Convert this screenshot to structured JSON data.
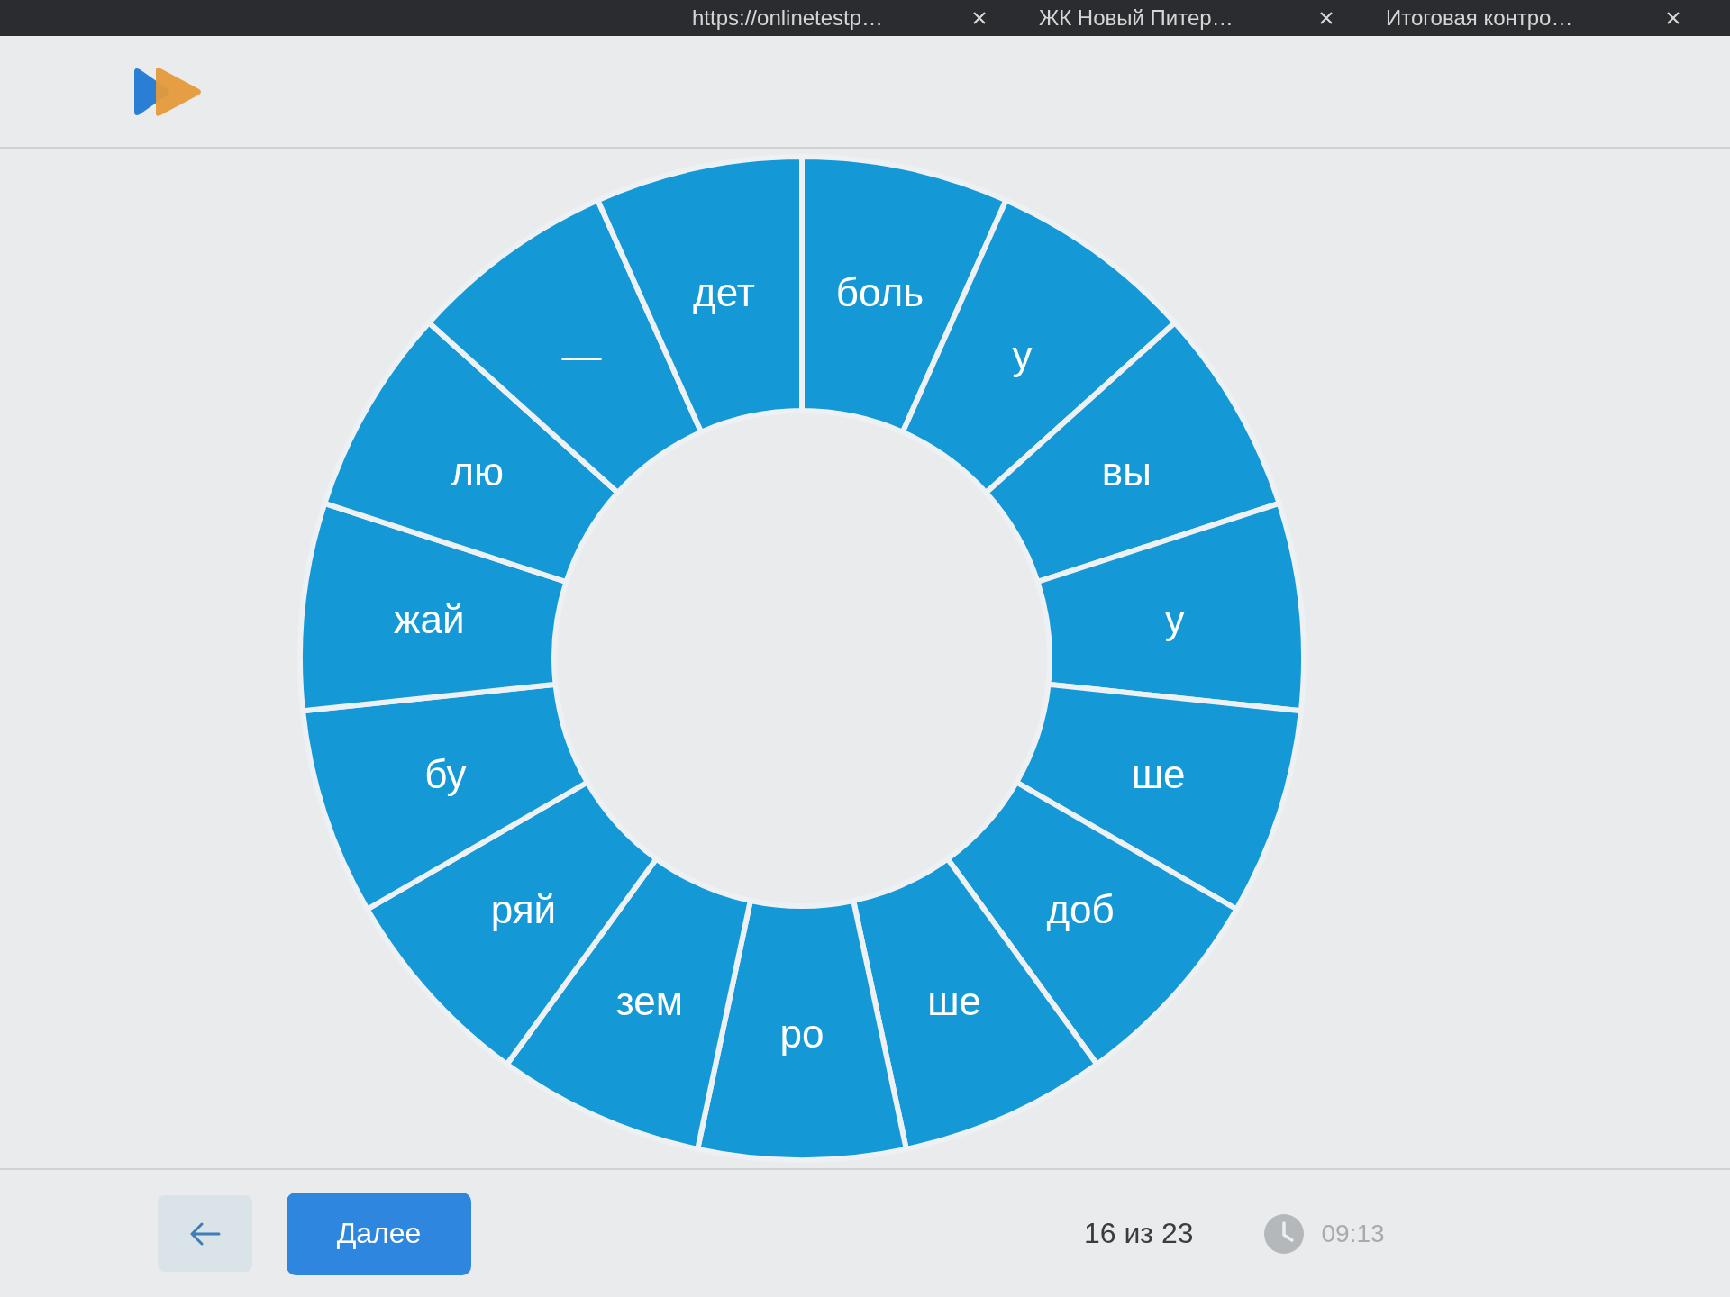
{
  "browser_tabs": [
    {
      "title": "https://onlinetestp…"
    },
    {
      "title": "ЖК Новый Питер…"
    },
    {
      "title": "Итоговая контро…"
    }
  ],
  "wheel": {
    "segments": [
      "боль",
      "у",
      "вы",
      "у",
      "ше",
      "доб",
      "ше",
      "ро",
      "зем",
      "ряй",
      "бу",
      "жай",
      "лю",
      "—",
      "дет"
    ]
  },
  "footer": {
    "next_button": "Далее",
    "progress": "16 из 23",
    "timer": "09:13"
  }
}
